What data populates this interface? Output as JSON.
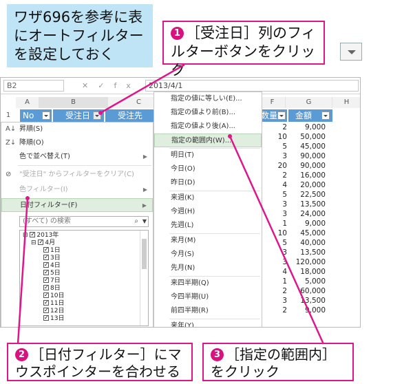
{
  "callouts": {
    "intro": "ワザ696を参考に表にオートフィルターを設定しておく",
    "step1": {
      "num": "1",
      "text": "［受注日］列のフィルターボタンをクリック"
    },
    "step2": {
      "num": "2",
      "text": "［日付フィルター］にマウスポインターを合わせる"
    },
    "step3": {
      "num": "3",
      "text": "［指定の範囲内］をクリック"
    }
  },
  "formula_bar": {
    "name_box": "B2",
    "cancel_icon": "✕",
    "enter_icon": "✓",
    "fx_icon": "fx",
    "value": "2013/4/1"
  },
  "columns": [
    "A",
    "B",
    "C",
    "F",
    "G",
    "H"
  ],
  "row1": {
    "num": "1",
    "no": "No",
    "date": "受注日",
    "customer": "受注先",
    "qty": "数量",
    "amount": "金額"
  },
  "rows": [
    {
      "qty": "2",
      "amount": "9,000"
    },
    {
      "qty": "10",
      "amount": "50,000"
    },
    {
      "qty": "5",
      "amount": "45,000"
    },
    {
      "qty": "3",
      "amount": "90,000"
    },
    {
      "qty": "20",
      "amount": "90,000"
    },
    {
      "qty": "2",
      "amount": "16,000"
    },
    {
      "qty": "4",
      "amount": "20,000"
    },
    {
      "qty": "5",
      "amount": "22,500"
    },
    {
      "qty": "3",
      "amount": "13,500"
    },
    {
      "qty": "3",
      "amount": "24,000"
    },
    {
      "qty": "1",
      "amount": "9,000"
    },
    {
      "qty": "10",
      "amount": "45,000"
    },
    {
      "qty": "5",
      "amount": "40,000"
    },
    {
      "qty": "3",
      "amount": "13,500"
    },
    {
      "qty": "3",
      "amount": "120,000"
    },
    {
      "qty": "4",
      "amount": "18,000"
    },
    {
      "qty": "1",
      "amount": "5,000"
    },
    {
      "qty": "2",
      "amount": "60,000"
    },
    {
      "qty": "3",
      "amount": "13,500"
    },
    {
      "qty": "2",
      "amount": "9,000"
    }
  ],
  "filter_menu": {
    "sort_asc": "昇順(S)",
    "sort_desc": "降順(O)",
    "sort_color": "色で並べ替え(T)",
    "clear_filter": "\"受注日\" からフィルターをクリア(C)",
    "color_filter": "色フィルター(I)",
    "date_filter": "日付フィルター(F)",
    "search_placeholder": "(すべて) の検索",
    "tree": {
      "year": "2013年",
      "month": "4月",
      "days": [
        "1日",
        "3日",
        "4日",
        "5日",
        "7日",
        "8日",
        "10日",
        "11日",
        "12日",
        "13日"
      ]
    }
  },
  "date_submenu": [
    "指定の値に等しい(E)...",
    "指定の値より前(B)...",
    "指定の値より後(A)...",
    "指定の範囲内(W)...",
    "明日(T)",
    "今日(O)",
    "昨日(D)",
    "来週(K)",
    "今週(H)",
    "先週(L)",
    "来月(M)",
    "今月(S)",
    "先月(N)",
    "来四半期(Q)",
    "今四半期(U)",
    "前四半期(R)",
    "来年(Y)"
  ],
  "colors": {
    "header_blue": "#5b9bd5",
    "callout_pink": "#e0158a",
    "highlight": "#dfeede",
    "intro_bg": "#bfe4f6"
  }
}
